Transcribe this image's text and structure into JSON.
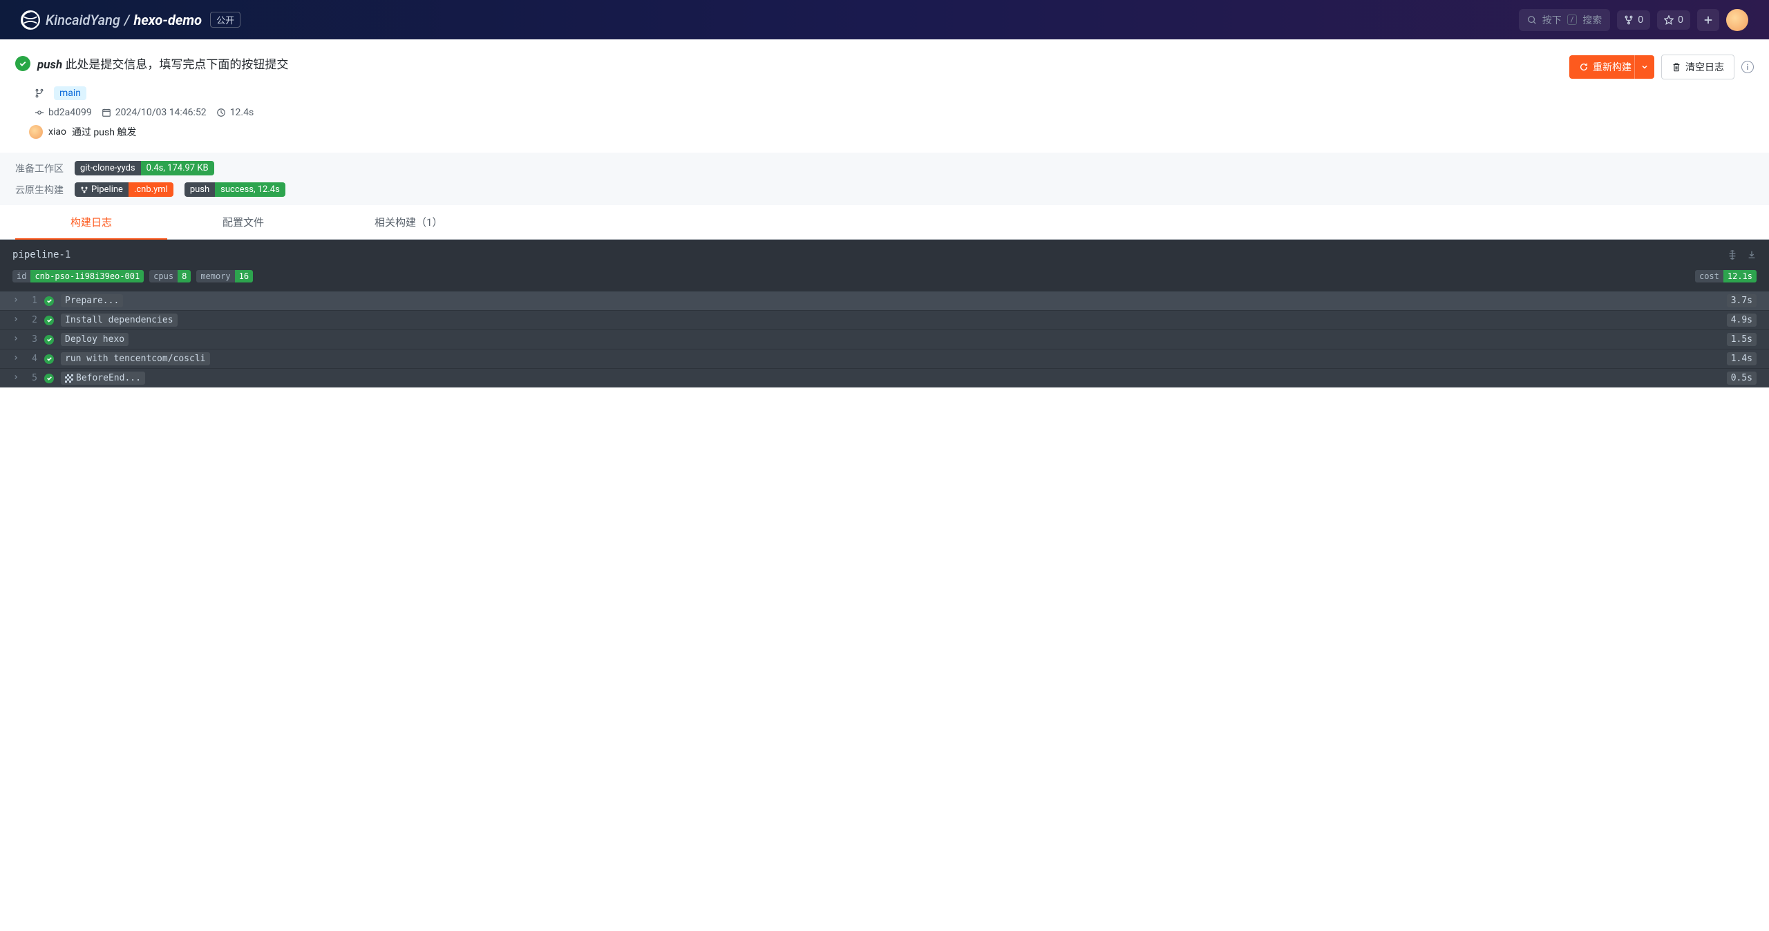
{
  "nav": {
    "owner": "KincaidYang",
    "repo": "hexo-demo",
    "visibility": "公开",
    "search_hint_left": "按下",
    "search_hint_key": "/",
    "search_hint_right": "搜索",
    "fork_count": "0",
    "star_count": "0"
  },
  "build": {
    "event": "push",
    "commit_message": "此处是提交信息，填写完点下面的按钮提交",
    "rebuild_label": "重新构建",
    "clear_log_label": "清空日志",
    "branch": "main",
    "commit_sha": "bd2a4099",
    "datetime": "2024/10/03 14:46:52",
    "duration": "12.4s",
    "trigger_user": "xiao",
    "trigger_text": "通过 push 触发"
  },
  "phases": {
    "prepare_label": "准备工作区",
    "prepare_tag_name": "git-clone-yyds",
    "prepare_tag_stats": "0.4s, 174.97 KB",
    "build_label": "云原生构建",
    "pipeline_tag": "Pipeline",
    "pipeline_file": ".cnb.yml",
    "push_tag": "push",
    "push_result": "success, 12.4s"
  },
  "tabs": {
    "log": "构建日志",
    "config": "配置文件",
    "related": "相关构建（1）"
  },
  "pipeline": {
    "name": "pipeline-1",
    "id_label": "id",
    "id_value": "cnb-pso-1i98i39eo-001",
    "cpus_label": "cpus",
    "cpus_value": "8",
    "memory_label": "memory",
    "memory_value": "16",
    "cost_label": "cost",
    "cost_value": "12.1s",
    "steps": [
      {
        "num": "1",
        "name": "Prepare...",
        "duration": "3.7s",
        "flag": false
      },
      {
        "num": "2",
        "name": "Install dependencies",
        "duration": "4.9s",
        "flag": false
      },
      {
        "num": "3",
        "name": "Deploy hexo",
        "duration": "1.5s",
        "flag": false
      },
      {
        "num": "4",
        "name": "run with tencentcom/coscli",
        "duration": "1.4s",
        "flag": false
      },
      {
        "num": "5",
        "name": "BeforeEnd...",
        "duration": "0.5s",
        "flag": true
      }
    ]
  }
}
